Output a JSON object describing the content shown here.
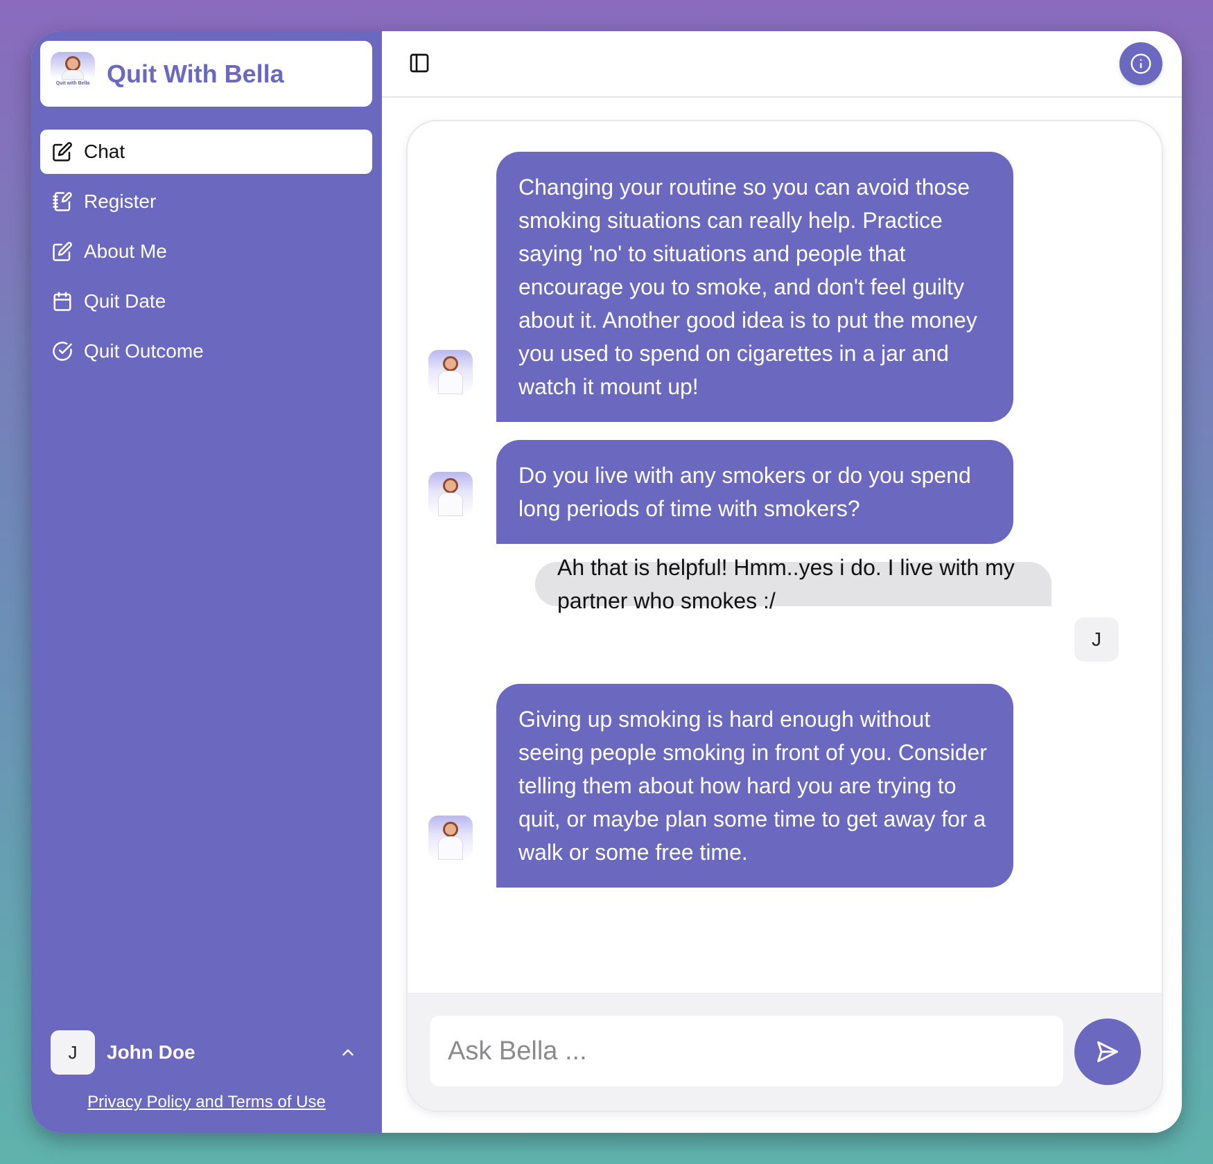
{
  "app": {
    "title": "Quit With Bella",
    "logo_caption": "Quit with Bella",
    "accent": "#6a68bf"
  },
  "sidebar": {
    "items": [
      {
        "label": "Chat",
        "icon": "edit-icon",
        "active": true
      },
      {
        "label": "Register",
        "icon": "notebook-icon",
        "active": false
      },
      {
        "label": "About Me",
        "icon": "edit-icon",
        "active": false
      },
      {
        "label": "Quit Date",
        "icon": "calendar-icon",
        "active": false
      },
      {
        "label": "Quit Outcome",
        "icon": "check-circle-icon",
        "active": false
      }
    ],
    "user": {
      "initial": "J",
      "name": "John Doe"
    },
    "privacy_link": "Privacy Policy and Terms of Use"
  },
  "chat": {
    "messages": [
      {
        "role": "bot",
        "text": "Changing your routine so you can avoid those smoking situations can really help. Practice saying 'no' to situations and people that encourage you to smoke, and don't feel guilty about it. Another good idea is to put the money you used to spend on cigarettes in a jar and watch it mount up!"
      },
      {
        "role": "bot",
        "text": "Do you live with any smokers or do you spend long periods of time with smokers?"
      },
      {
        "role": "user",
        "text": "Ah that is helpful! Hmm..yes i do. I live with my partner who smokes :/",
        "initial": "J"
      },
      {
        "role": "bot",
        "text": "Giving up smoking is hard enough without seeing people smoking in front of you. Consider telling them about how hard you are trying to quit, or maybe plan some time to get away for a walk or some free time."
      }
    ],
    "input_placeholder": "Ask Bella ..."
  }
}
